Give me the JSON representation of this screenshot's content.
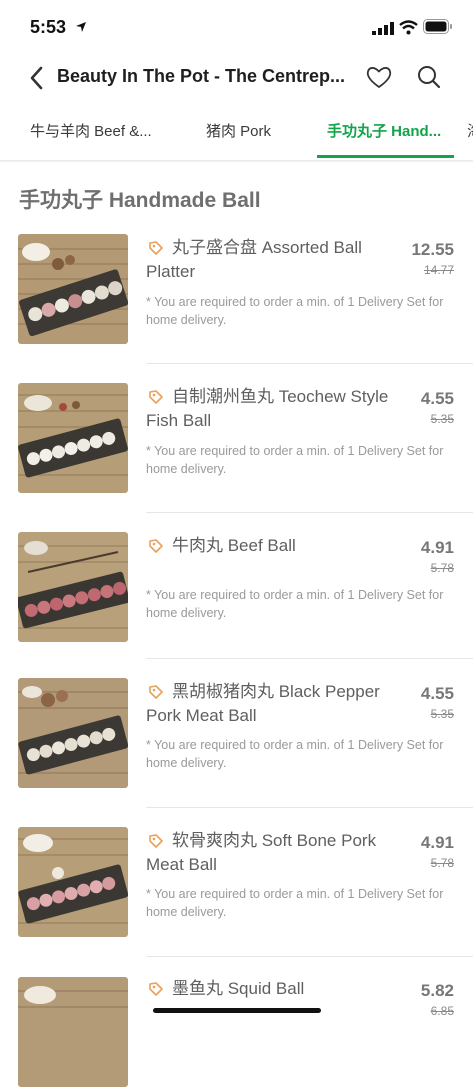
{
  "status": {
    "time": "5:53"
  },
  "header": {
    "title": "Beauty In The Pot - The Centrep..."
  },
  "tabs": [
    {
      "label": "牛与羊肉 Beef &..."
    },
    {
      "label": "猪肉 Pork"
    },
    {
      "label": "手功丸子 Hand..."
    },
    {
      "label": "海"
    }
  ],
  "section": {
    "title": "手功丸子 Handmade Ball"
  },
  "items": [
    {
      "name": "丸子盛合盘 Assorted Ball Platter",
      "price": "12.55",
      "old_price": "14.77",
      "note": "* You are required to order a min. of 1 Delivery Set for home delivery."
    },
    {
      "name": "自制潮州鱼丸 Teochew Style Fish Ball",
      "price": "4.55",
      "old_price": "5.35",
      "note": "* You are required to order a min. of 1 Delivery Set for home delivery."
    },
    {
      "name": "牛肉丸 Beef Ball",
      "price": "4.91",
      "old_price": "5.78",
      "note": "* You are required to order a min. of 1 Delivery Set for home delivery."
    },
    {
      "name": "黑胡椒猪肉丸 Black Pepper Pork Meat Ball",
      "price": "4.55",
      "old_price": "5.35",
      "note": "* You are required to order a min. of 1 Delivery Set for home delivery."
    },
    {
      "name": "软骨爽肉丸 Soft Bone Pork Meat Ball",
      "price": "4.91",
      "old_price": "5.78",
      "note": "* You are required to order a min. of 1 Delivery Set for home delivery."
    },
    {
      "name": "墨鱼丸 Squid Ball",
      "price": "5.82",
      "old_price": "6.85",
      "note": ""
    }
  ],
  "colors": {
    "accent": "#12a44a",
    "tag_orange": "#e8a15a"
  }
}
